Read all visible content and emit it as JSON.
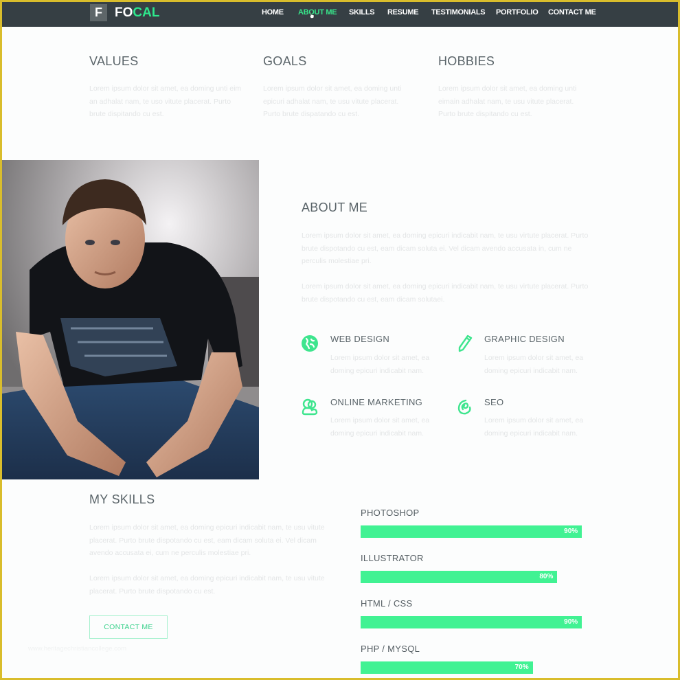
{
  "brand": {
    "logo_letter": "F",
    "name_part1": "FO",
    "name_part2": "CAL"
  },
  "colors": {
    "accent": "#41f293",
    "nav_bg": "#363f44",
    "heading": "#5a6469",
    "frame": "#d9bd2c"
  },
  "nav": {
    "items": [
      {
        "label": "HOME",
        "active": false
      },
      {
        "label": "ABOUT ME",
        "active": true
      },
      {
        "label": "SKILLS",
        "active": false
      },
      {
        "label": "RESUME",
        "active": false
      },
      {
        "label": "TESTIMONIALS",
        "active": false
      },
      {
        "label": "PORTFOLIO",
        "active": false
      },
      {
        "label": "CONTACT ME",
        "active": false
      }
    ]
  },
  "intro": {
    "columns": [
      {
        "title": "VALUES",
        "text": "Lorem ipsum dolor sit amet, ea doming unti eim an adhalat nam, te uso vitute placerat. Purto brute dispitando cu est."
      },
      {
        "title": "GOALS",
        "text": "Lorem ipsum dolor sit amet, ea doming unti epicuri adhalat nam, te usu vitute placerat. Purto brute dispatando cu est."
      },
      {
        "title": "HOBBIES",
        "text": "Lorem ipsum dolor sit amet, ea doming unti eimain adhalat nam, te usu vitute placerat. Purto brute dispitando cu est."
      }
    ]
  },
  "about": {
    "title": "ABOUT ME",
    "paragraphs": [
      "Lorem ipsum dolor sit amet, ea doming epicuri indicabit nam, te usu virtute placerat. Purto brute dispotando cu est, eam dicam soluta ei. Vel dicam avendo accusata in, cum ne perculis molestiae pri.",
      "Lorem ipsum dolor sit amet, ea doming epicuri indicabit nam, te usu virtute placerat. Purto brute dispotando cu est, eam dicam solutaei."
    ],
    "services": [
      {
        "icon": "globe-icon",
        "title": "WEB DESIGN",
        "text": "Lorem ipsum dolor sit amet, ea doming epicuri indicabit nam."
      },
      {
        "icon": "pencil-icon",
        "title": "GRAPHIC DESIGN",
        "text": "Lorem ipsum dolor sit amet, ea doming epicuri indicabit nam."
      },
      {
        "icon": "users-icon",
        "title": "ONLINE MARKETING",
        "text": "Lorem ipsum dolor sit amet, ea doming epicuri indicabit nam."
      },
      {
        "icon": "at-icon",
        "title": "SEO",
        "text": "Lorem ipsum dolor sit amet, ea doming epicuri indicabit nam."
      }
    ]
  },
  "skills": {
    "title": "MY SKILLS",
    "paragraphs": [
      "Lorem ipsum dolor sit amet, ea doming epicuri indicabit nam, te usu vitute placerat. Purto brute dispotando cu est, eam dicam soluta ei. Vel dicam avendo accusata ei, cum ne perculis molestiae pri.",
      "Lorem ipsum dolor sit amet, ea doming epicuri indicabit nam, te usu vitute placerat. Purto brute dispotando cu est."
    ],
    "contact_button": "CONTACT ME",
    "bars": [
      {
        "label": "PHOTOSHOP",
        "percent": 90,
        "percent_label": "90%"
      },
      {
        "label": "ILLUSTRATOR",
        "percent": 80,
        "percent_label": "80%"
      },
      {
        "label": "HTML / CSS",
        "percent": 90,
        "percent_label": "90%"
      },
      {
        "label": "PHP / MYSQL",
        "percent": 70,
        "percent_label": "70%"
      }
    ]
  },
  "watermark": "www.heritagechristiancollege.com"
}
